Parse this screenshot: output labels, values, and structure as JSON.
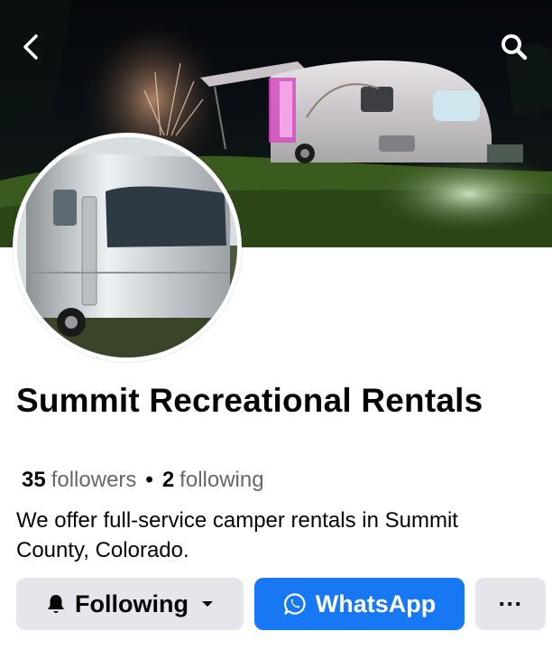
{
  "header": {
    "back_icon": "chevron-left-icon",
    "search_icon": "search-icon"
  },
  "profile": {
    "name": "Summit Recreational Rentals",
    "followers_count": "35",
    "followers_label": "followers",
    "separator": "•",
    "following_count": "2",
    "following_label": "following",
    "bio": "We offer full-service camper rentals in Summit County, Colorado."
  },
  "actions": {
    "following_label": "Following",
    "following_icon": "bell-icon",
    "whatsapp_label": "WhatsApp",
    "whatsapp_icon": "whatsapp-icon",
    "more_label": "···"
  },
  "colors": {
    "primary_blue": "#1877f2",
    "secondary_button": "#e4e6eb",
    "muted_text": "#65676b"
  }
}
